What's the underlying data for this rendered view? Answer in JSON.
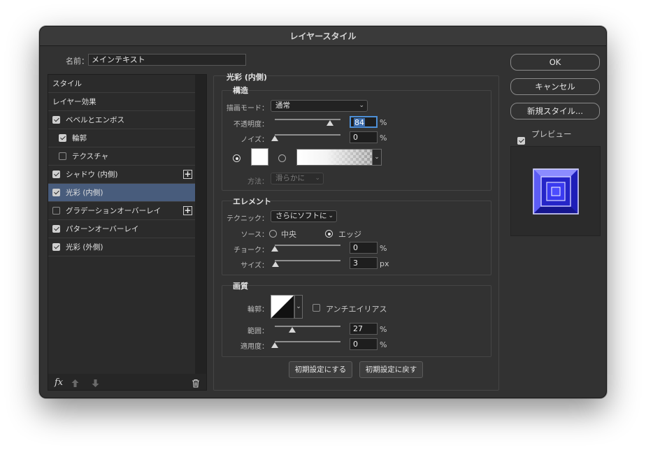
{
  "window": {
    "title": "レイヤースタイル"
  },
  "name_field": {
    "label": "名前：",
    "value": "メインテキスト"
  },
  "styles_list": {
    "items": [
      {
        "label": "スタイル",
        "checkbox": "none",
        "plus": false,
        "selected": false,
        "indent": 0
      },
      {
        "label": "レイヤー効果",
        "checkbox": "none",
        "plus": false,
        "selected": false,
        "indent": 0
      },
      {
        "label": "ベベルとエンボス",
        "checkbox": "on",
        "plus": false,
        "selected": false,
        "indent": 0
      },
      {
        "label": "輪郭",
        "checkbox": "on",
        "plus": false,
        "selected": false,
        "indent": 1
      },
      {
        "label": "テクスチャ",
        "checkbox": "off",
        "plus": false,
        "selected": false,
        "indent": 1
      },
      {
        "label": "シャドウ (内側)",
        "checkbox": "on",
        "plus": true,
        "selected": false,
        "indent": 0
      },
      {
        "label": "光彩 (内側)",
        "checkbox": "on",
        "plus": false,
        "selected": true,
        "indent": 0
      },
      {
        "label": "グラデーションオーバーレイ",
        "checkbox": "off",
        "plus": true,
        "selected": false,
        "indent": 0
      },
      {
        "label": "パターンオーバーレイ",
        "checkbox": "on",
        "plus": false,
        "selected": false,
        "indent": 0
      },
      {
        "label": "光彩 (外側)",
        "checkbox": "on",
        "plus": false,
        "selected": false,
        "indent": 0
      }
    ],
    "fx_label": "fx"
  },
  "panel": {
    "section_title": "光彩 (内側)",
    "structure": {
      "title": "構造",
      "blend_mode_label": "描画モード：",
      "blend_mode_value": "通常",
      "opacity_label": "不透明度：",
      "opacity_value": "84",
      "opacity_pct": 84,
      "noise_label": "ノイズ：",
      "noise_value": "0",
      "noise_pct": 0,
      "unit_pct": "%",
      "method_label": "方法：",
      "method_value": "滑らかに"
    },
    "elements": {
      "title": "エレメント",
      "technique_label": "テクニック：",
      "technique_value": "さらにソフトに",
      "source_label": "ソース：",
      "source_center": "中央",
      "source_edge": "エッジ",
      "choke_label": "チョーク：",
      "choke_value": "0",
      "choke_pct": 0,
      "size_label": "サイズ：",
      "size_value": "3",
      "size_unit": "px",
      "size_max": 250
    },
    "quality": {
      "title": "画質",
      "contour_label": "輪郭：",
      "antialias_label": "アンチエイリアス",
      "range_label": "範囲：",
      "range_value": "27",
      "range_pct": 27,
      "jitter_label": "適用度：",
      "jitter_value": "0",
      "jitter_pct": 0
    },
    "buttons": {
      "make_default": "初期設定にする",
      "reset_default": "初期設定に戻す"
    }
  },
  "right": {
    "ok": "OK",
    "cancel": "キャンセル",
    "new_style": "新規スタイル...",
    "preview_label": "プレビュー"
  },
  "colors": {
    "window_bg": "#323232",
    "selected_row": "#485c7c",
    "focus_blue": "#4d8fd6",
    "preview_blue": "#2e2ee0"
  }
}
